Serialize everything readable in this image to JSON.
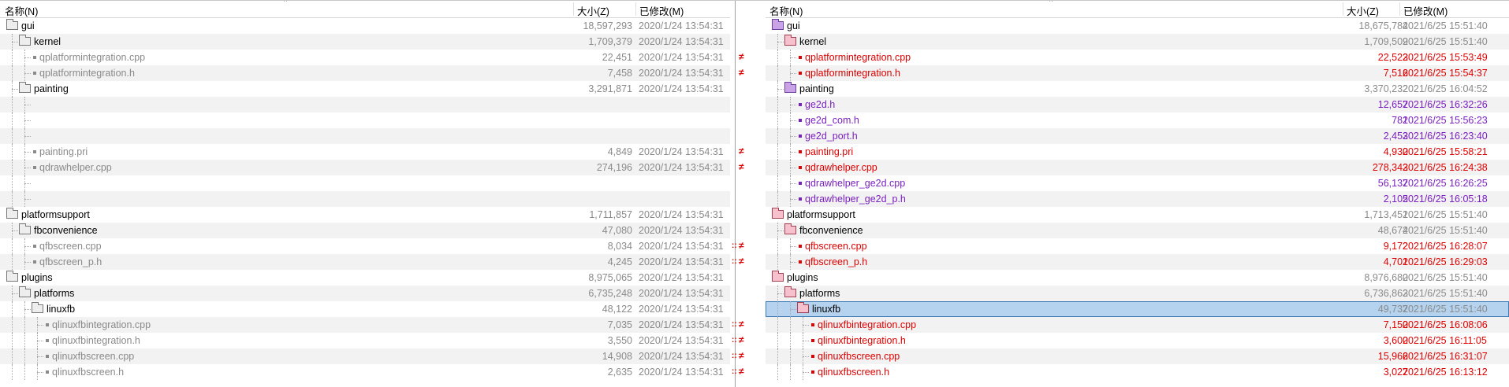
{
  "headers": {
    "name": "名称(N)",
    "size": "大小(Z)",
    "modified": "已修改(M)"
  },
  "left_rows": [
    {
      "depth": 0,
      "kind": "folder",
      "name": "gui",
      "size": "18,597,293",
      "date": "2020/1/24 13:54:31",
      "color": "blk",
      "status": ""
    },
    {
      "depth": 1,
      "kind": "folder",
      "name": "kernel",
      "size": "1,709,379",
      "date": "2020/1/24 13:54:31",
      "color": "blk",
      "status": ""
    },
    {
      "depth": 2,
      "kind": "file",
      "name": "qplatformintegration.cpp",
      "size": "22,451",
      "date": "2020/1/24 13:54:31",
      "color": "gray",
      "status": "≠"
    },
    {
      "depth": 2,
      "kind": "file",
      "name": "qplatformintegration.h",
      "size": "7,458",
      "date": "2020/1/24 13:54:31",
      "color": "gray",
      "status": "≠"
    },
    {
      "depth": 1,
      "kind": "folder",
      "name": "painting",
      "size": "3,291,871",
      "date": "2020/1/24 13:54:31",
      "color": "blk",
      "status": ""
    },
    {
      "depth": 2,
      "kind": "blank",
      "name": "",
      "size": "",
      "date": "",
      "color": "gray",
      "status": ""
    },
    {
      "depth": 2,
      "kind": "blank",
      "name": "",
      "size": "",
      "date": "",
      "color": "gray",
      "status": ""
    },
    {
      "depth": 2,
      "kind": "blank",
      "name": "",
      "size": "",
      "date": "",
      "color": "gray",
      "status": ""
    },
    {
      "depth": 2,
      "kind": "file",
      "name": "painting.pri",
      "size": "4,849",
      "date": "2020/1/24 13:54:31",
      "color": "gray",
      "status": "≠"
    },
    {
      "depth": 2,
      "kind": "file",
      "name": "qdrawhelper.cpp",
      "size": "274,196",
      "date": "2020/1/24 13:54:31",
      "color": "gray",
      "status": "≠"
    },
    {
      "depth": 2,
      "kind": "blank",
      "name": "",
      "size": "",
      "date": "",
      "color": "gray",
      "status": ""
    },
    {
      "depth": 2,
      "kind": "blank",
      "name": "",
      "size": "",
      "date": "",
      "color": "gray",
      "status": ""
    },
    {
      "depth": 0,
      "kind": "folder",
      "name": "platformsupport",
      "size": "1,711,857",
      "date": "2020/1/24 13:54:31",
      "color": "blk",
      "status": ""
    },
    {
      "depth": 1,
      "kind": "folder",
      "name": "fbconvenience",
      "size": "47,080",
      "date": "2020/1/24 13:54:31",
      "color": "blk",
      "status": ""
    },
    {
      "depth": 2,
      "kind": "file",
      "name": "qfbscreen.cpp",
      "size": "8,034",
      "date": "2020/1/24 13:54:31",
      "color": "gray",
      "status": "::≠"
    },
    {
      "depth": 2,
      "kind": "file",
      "name": "qfbscreen_p.h",
      "size": "4,245",
      "date": "2020/1/24 13:54:31",
      "color": "gray",
      "status": "::≠"
    },
    {
      "depth": 0,
      "kind": "folder",
      "name": "plugins",
      "size": "8,975,065",
      "date": "2020/1/24 13:54:31",
      "color": "blk",
      "status": ""
    },
    {
      "depth": 1,
      "kind": "folder",
      "name": "platforms",
      "size": "6,735,248",
      "date": "2020/1/24 13:54:31",
      "color": "blk",
      "status": ""
    },
    {
      "depth": 2,
      "kind": "folder",
      "name": "linuxfb",
      "size": "48,122",
      "date": "2020/1/24 13:54:31",
      "color": "blk",
      "status": ""
    },
    {
      "depth": 3,
      "kind": "file",
      "name": "qlinuxfbintegration.cpp",
      "size": "7,035",
      "date": "2020/1/24 13:54:31",
      "color": "gray",
      "status": "::≠"
    },
    {
      "depth": 3,
      "kind": "file",
      "name": "qlinuxfbintegration.h",
      "size": "3,550",
      "date": "2020/1/24 13:54:31",
      "color": "gray",
      "status": "::≠"
    },
    {
      "depth": 3,
      "kind": "file",
      "name": "qlinuxfbscreen.cpp",
      "size": "14,908",
      "date": "2020/1/24 13:54:31",
      "color": "gray",
      "status": "::≠"
    },
    {
      "depth": 3,
      "kind": "file",
      "name": "qlinuxfbscreen.h",
      "size": "2,635",
      "date": "2020/1/24 13:54:31",
      "color": "gray",
      "status": "::≠"
    }
  ],
  "right_rows": [
    {
      "depth": 0,
      "kind": "folder",
      "folder_color": "purp",
      "name": "gui",
      "size": "18,675,784",
      "date": "2021/6/25 15:51:40",
      "color": "blk",
      "size_color": "gray"
    },
    {
      "depth": 1,
      "kind": "folder",
      "folder_color": "pink",
      "name": "kernel",
      "size": "1,709,509",
      "date": "2021/6/25 15:51:40",
      "color": "blk",
      "size_color": "gray"
    },
    {
      "depth": 2,
      "kind": "file",
      "name": "qplatformintegration.cpp",
      "size": "22,523",
      "date": "2021/6/25 15:53:49",
      "color": "red",
      "size_color": "red"
    },
    {
      "depth": 2,
      "kind": "file",
      "name": "qplatformintegration.h",
      "size": "7,516",
      "date": "2021/6/25 15:54:37",
      "color": "red",
      "size_color": "red"
    },
    {
      "depth": 1,
      "kind": "folder",
      "folder_color": "purp",
      "name": "painting",
      "size": "3,370,232",
      "date": "2021/6/25 16:04:52",
      "color": "blk",
      "size_color": "gray"
    },
    {
      "depth": 2,
      "kind": "file",
      "name": "ge2d.h",
      "size": "12,657",
      "date": "2021/6/25 16:32:26",
      "color": "purple",
      "size_color": "purple"
    },
    {
      "depth": 2,
      "kind": "file",
      "name": "ge2d_com.h",
      "size": "781",
      "date": "2021/6/25 15:56:23",
      "color": "purple",
      "size_color": "purple"
    },
    {
      "depth": 2,
      "kind": "file",
      "name": "ge2d_port.h",
      "size": "2,453",
      "date": "2021/6/25 16:23:40",
      "color": "purple",
      "size_color": "purple"
    },
    {
      "depth": 2,
      "kind": "file",
      "name": "painting.pri",
      "size": "4,930",
      "date": "2021/6/25 15:58:21",
      "color": "red",
      "size_color": "red"
    },
    {
      "depth": 2,
      "kind": "file",
      "name": "qdrawhelper.cpp",
      "size": "278,343",
      "date": "2021/6/25 16:24:38",
      "color": "red",
      "size_color": "red"
    },
    {
      "depth": 2,
      "kind": "file",
      "name": "qdrawhelper_ge2d.cpp",
      "size": "56,137",
      "date": "2021/6/25 16:26:25",
      "color": "purple",
      "size_color": "purple"
    },
    {
      "depth": 2,
      "kind": "file",
      "name": "qdrawhelper_ge2d_p.h",
      "size": "2,105",
      "date": "2021/6/25 16:05:18",
      "color": "purple",
      "size_color": "purple"
    },
    {
      "depth": 0,
      "kind": "folder",
      "folder_color": "pink",
      "name": "platformsupport",
      "size": "1,713,451",
      "date": "2021/6/25 15:51:40",
      "color": "blk",
      "size_color": "gray"
    },
    {
      "depth": 1,
      "kind": "folder",
      "folder_color": "pink",
      "name": "fbconvenience",
      "size": "48,674",
      "date": "2021/6/25 15:51:40",
      "color": "blk",
      "size_color": "gray"
    },
    {
      "depth": 2,
      "kind": "file",
      "name": "qfbscreen.cpp",
      "size": "9,172",
      "date": "2021/6/25 16:28:07",
      "color": "red",
      "size_color": "red"
    },
    {
      "depth": 2,
      "kind": "file",
      "name": "qfbscreen_p.h",
      "size": "4,701",
      "date": "2021/6/25 16:29:03",
      "color": "red",
      "size_color": "red"
    },
    {
      "depth": 0,
      "kind": "folder",
      "folder_color": "pink",
      "name": "plugins",
      "size": "8,976,680",
      "date": "2021/6/25 15:51:40",
      "color": "blk",
      "size_color": "gray"
    },
    {
      "depth": 1,
      "kind": "folder",
      "folder_color": "pink",
      "name": "platforms",
      "size": "6,736,863",
      "date": "2021/6/25 15:51:40",
      "color": "blk",
      "size_color": "gray"
    },
    {
      "depth": 2,
      "kind": "folder",
      "folder_color": "pink",
      "name": "linuxfb",
      "size": "49,737",
      "date": "2021/6/25 15:51:40",
      "color": "blk",
      "size_color": "gray",
      "selected": true
    },
    {
      "depth": 3,
      "kind": "file",
      "name": "qlinuxfbintegration.cpp",
      "size": "7,150",
      "date": "2021/6/25 16:08:06",
      "color": "red",
      "size_color": "red"
    },
    {
      "depth": 3,
      "kind": "file",
      "name": "qlinuxfbintegration.h",
      "size": "3,600",
      "date": "2021/6/25 16:11:05",
      "color": "red",
      "size_color": "red"
    },
    {
      "depth": 3,
      "kind": "file",
      "name": "qlinuxfbscreen.cpp",
      "size": "15,966",
      "date": "2021/6/25 16:31:07",
      "color": "red",
      "size_color": "red"
    },
    {
      "depth": 3,
      "kind": "file",
      "name": "qlinuxfbscreen.h",
      "size": "3,027",
      "date": "2021/6/25 16:13:12",
      "color": "red",
      "size_color": "red"
    }
  ],
  "colors": {
    "red": "#e00000",
    "purple": "#7a1fc0",
    "gray": "#8a8a8a",
    "selection": "#b5d3ef"
  }
}
